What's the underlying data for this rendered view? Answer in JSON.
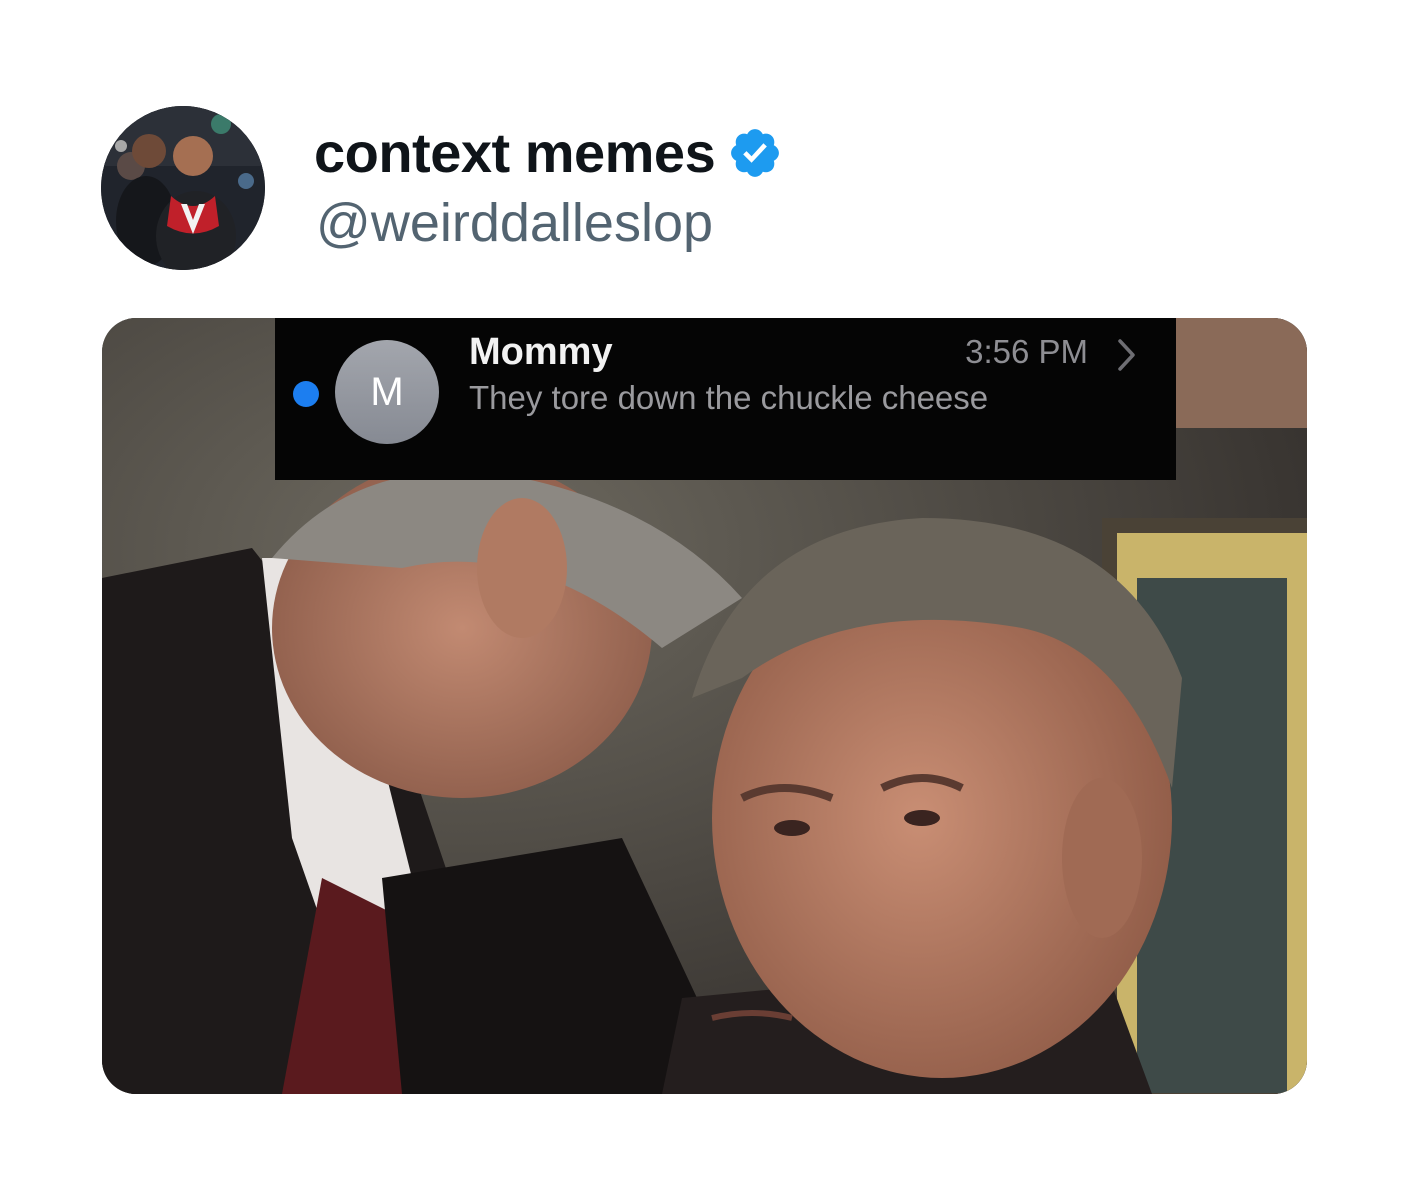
{
  "tweet": {
    "display_name": "context memes",
    "handle": "@weirddalleslop",
    "verified_icon": "verified-badge-icon",
    "accent_color": "#1d9bf0"
  },
  "notification": {
    "contact_initial": "M",
    "sender": "Mommy",
    "time": "3:56 PM",
    "message": "They tore down the chuckle cheese",
    "unread_color": "#1c7ef0"
  }
}
